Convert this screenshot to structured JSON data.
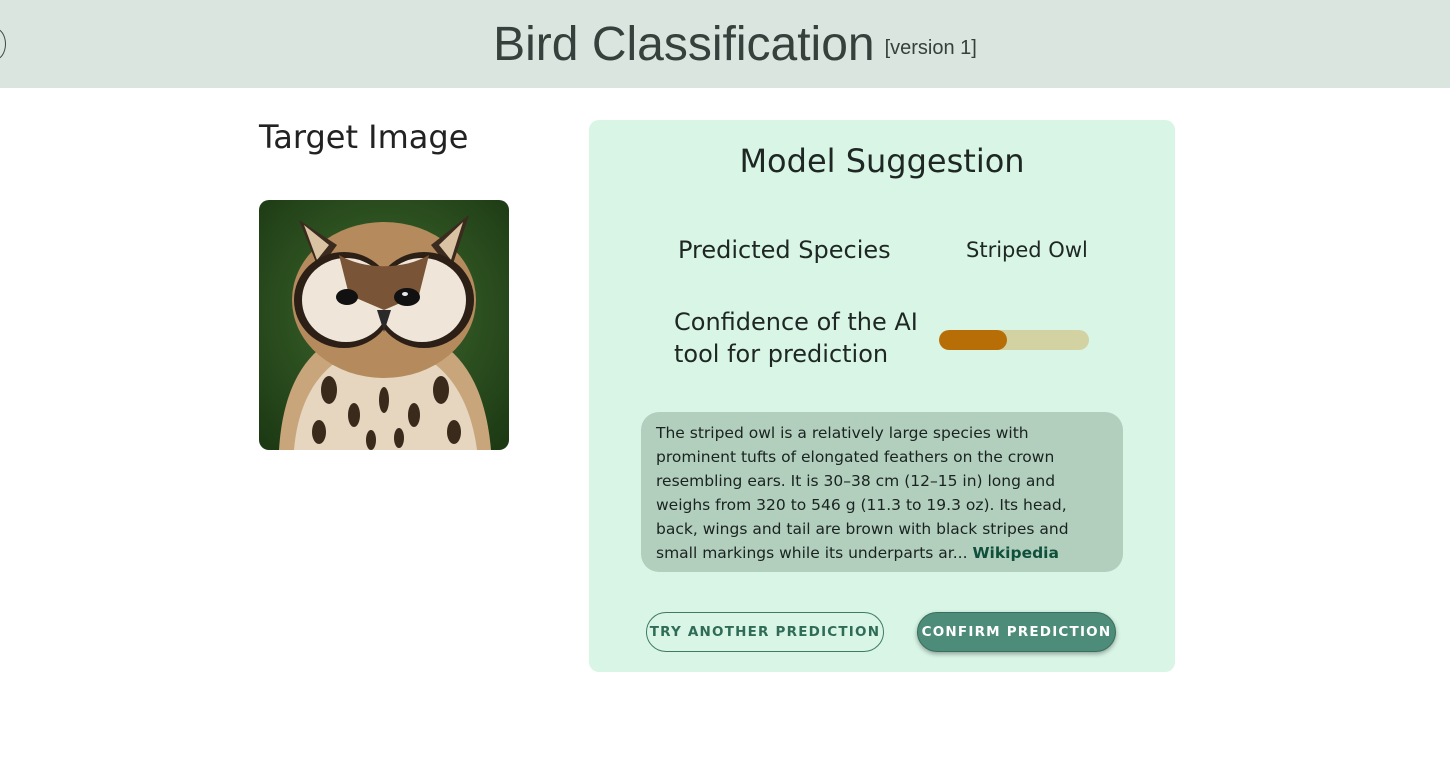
{
  "header": {
    "title": "Bird Classification",
    "version": "[version 1]"
  },
  "target": {
    "heading": "Target Image"
  },
  "model": {
    "heading": "Model Suggestion",
    "species_label": "Predicted Species",
    "species_value": "Striped Owl",
    "confidence_label": "Confidence of the AI tool for prediction",
    "confidence_fraction": 0.45,
    "description": "The striped owl is a relatively large species with prominent tufts of elongated feathers on the crown resembling ears. It is 30–38 cm (12–15 in) long and weighs from 320 to 546 g (11.3 to 19.3 oz). Its head, back, wings and tail are brown with black stripes and small markings while its underparts ar...",
    "source_link": "Wikipedia"
  },
  "actions": {
    "try_another": "TRY ANOTHER PREDICTION",
    "confirm": "CONFIRM PREDICTION"
  },
  "colors": {
    "header_bg": "#dbe5df",
    "panel_bg": "#d8f5e6",
    "description_bg": "#b2cfbe",
    "confidence_fill": "#b86e06",
    "confidence_track": "#d3d2a3",
    "primary_button": "#4d8c78"
  },
  "icons": {
    "header_left": "circle-icon"
  }
}
